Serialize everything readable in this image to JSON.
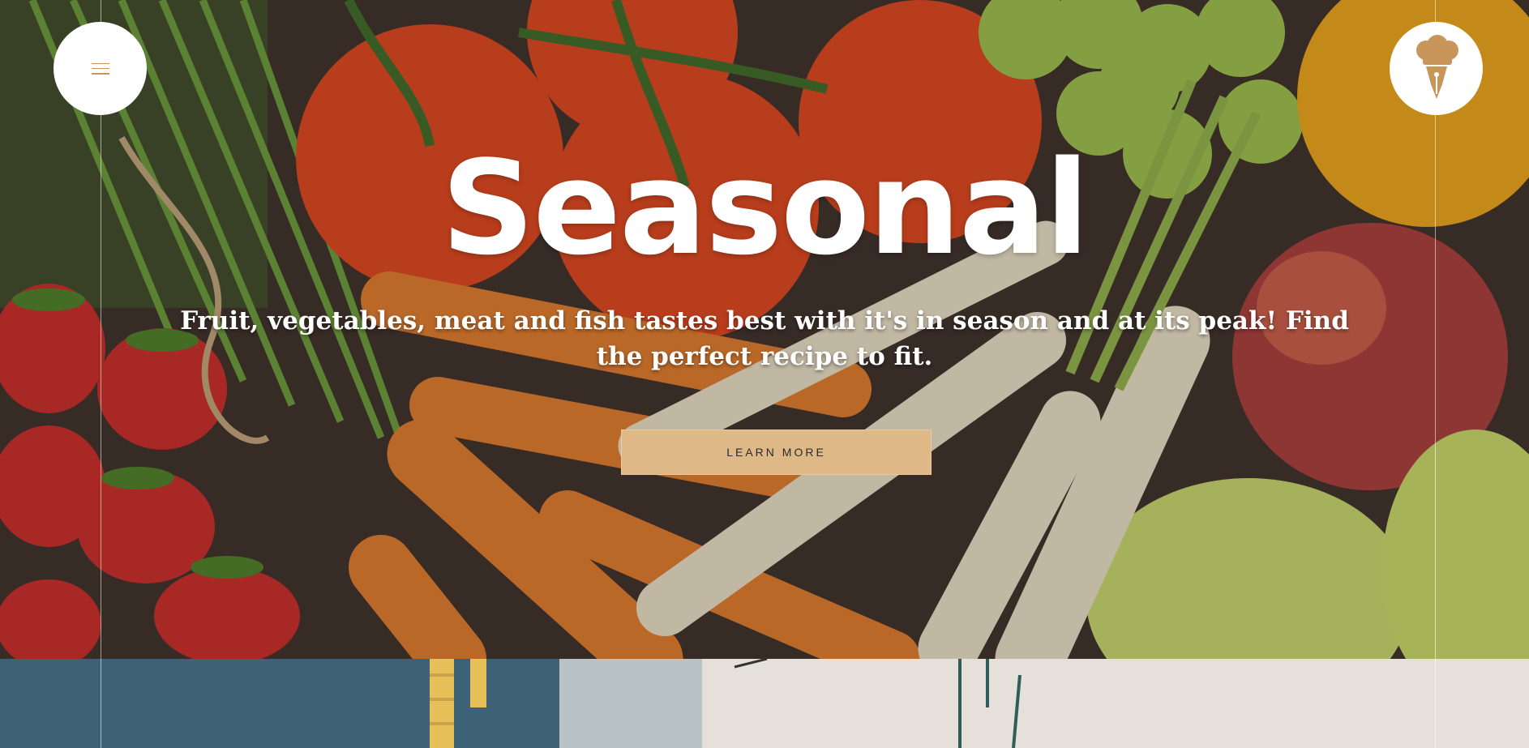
{
  "nav": {
    "menu_icon": "hamburger-menu-icon",
    "logo_icon": "chef-hat-pen-logo"
  },
  "hero": {
    "title": "Seasonal",
    "subtitle": "Fruit, vegetables, meat and fish tastes best with it's in season and at its peak! Find the perfect recipe to fit.",
    "cta_label": "LEARN MORE"
  },
  "colors": {
    "accent": "#deb886",
    "menu_icon": "#c8965a",
    "lower_left": "#3d6275",
    "lower_right": "#e5e0da"
  }
}
